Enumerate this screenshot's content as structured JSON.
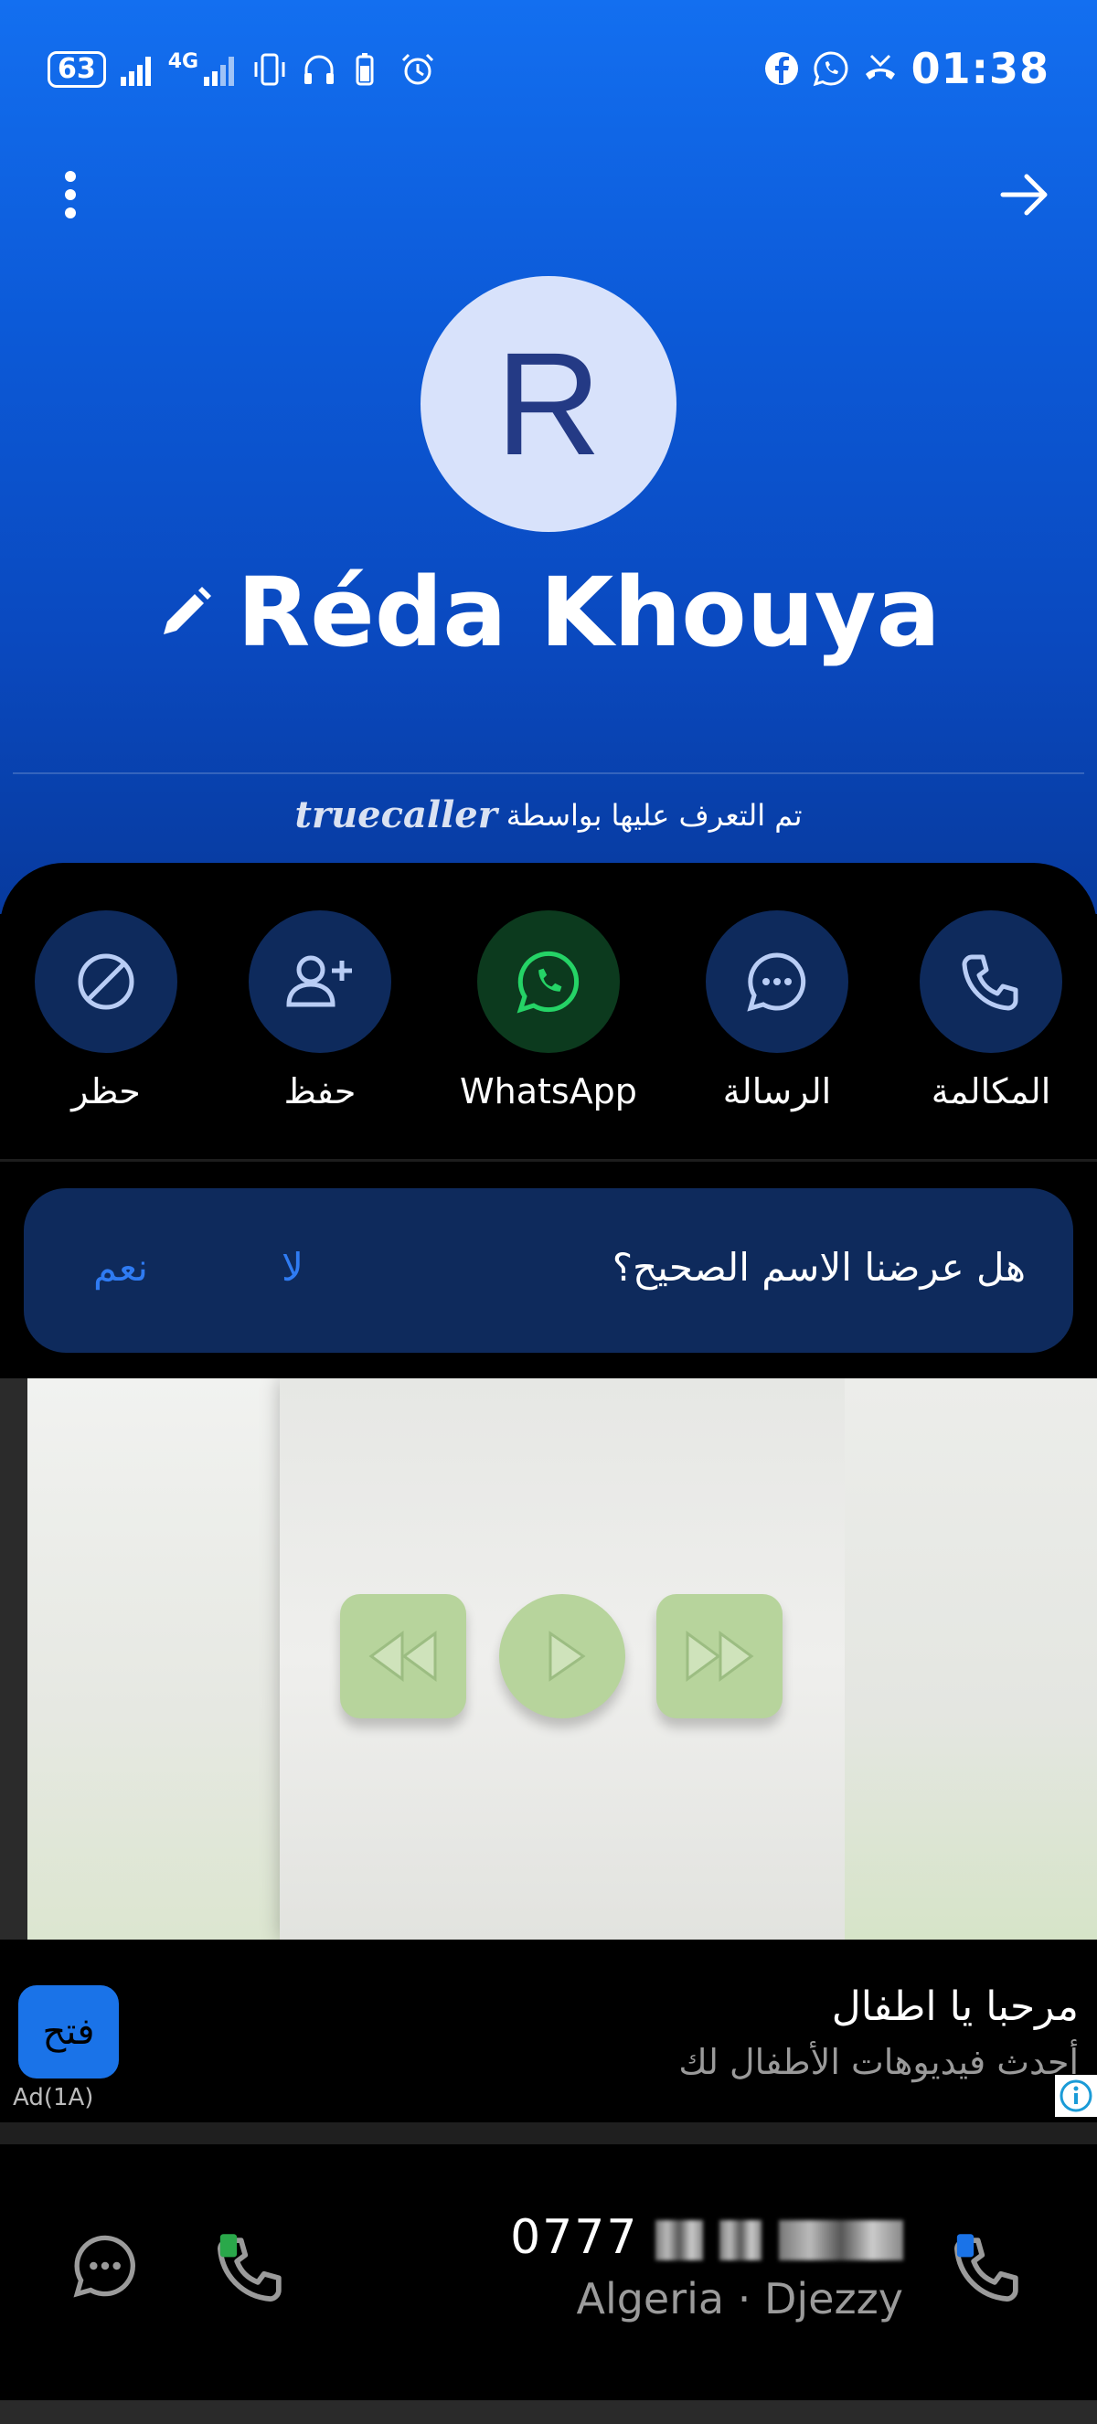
{
  "status_bar": {
    "battery": "63",
    "network": "4G",
    "time": "01:38"
  },
  "contact": {
    "initial": "R",
    "name": "Réda Khouya",
    "identified_text": "تم التعرف عليها بواسطة",
    "identified_brand": "truecaller"
  },
  "actions": {
    "call": "المكالمة",
    "message": "الرسالة",
    "whatsapp": "WhatsApp",
    "save": "حفظ",
    "block": "حظر"
  },
  "name_check": {
    "question": "هل عرضنا الاسم الصحيح؟",
    "no": "لا",
    "yes": "نعم"
  },
  "ad": {
    "title": "مرحبا يا اطفال",
    "subtitle": "أحدث فيديوهات الأطفال لك",
    "open_button": "فتح",
    "tag": "Ad(1A)"
  },
  "number_row": {
    "number_prefix": "0777",
    "carrier": "Algeria · Djezzy"
  },
  "colors": {
    "hero_top": "#136ff0",
    "accent": "#2f7bf2",
    "action_circle": "#0e2a5c",
    "whatsapp_circle": "#0c3a1e",
    "whatsapp_green": "#25d366"
  }
}
